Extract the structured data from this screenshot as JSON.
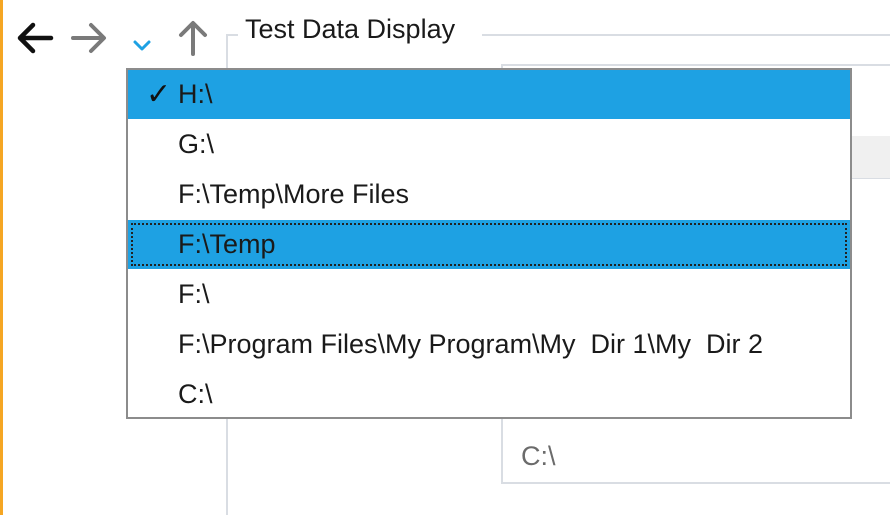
{
  "nav": {
    "back_icon": "arrow-left-icon",
    "forward_icon": "arrow-right-icon",
    "recent_icon": "chevron-down-icon",
    "up_icon": "arrow-up-icon",
    "accent_color": "#1ea1e3"
  },
  "group": {
    "title": "Test Data Display"
  },
  "background_list": {
    "last_item": "C:\\"
  },
  "dropdown": {
    "checkmark": "✓",
    "items": [
      {
        "label": "H:\\",
        "checked": true,
        "highlighted": true
      },
      {
        "label": "G:\\",
        "checked": false,
        "highlighted": false
      },
      {
        "label": "F:\\Temp\\More Files",
        "checked": false,
        "highlighted": false
      },
      {
        "label": "F:\\Temp",
        "checked": false,
        "highlighted": true,
        "focused": true
      },
      {
        "label": "F:\\",
        "checked": false,
        "highlighted": false
      },
      {
        "label": "F:\\Program Files\\My Program\\My  Dir 1\\My  Dir 2",
        "checked": false,
        "highlighted": false
      },
      {
        "label": "C:\\",
        "checked": false,
        "highlighted": false
      }
    ],
    "highlight_color": "#1ea1e3"
  }
}
